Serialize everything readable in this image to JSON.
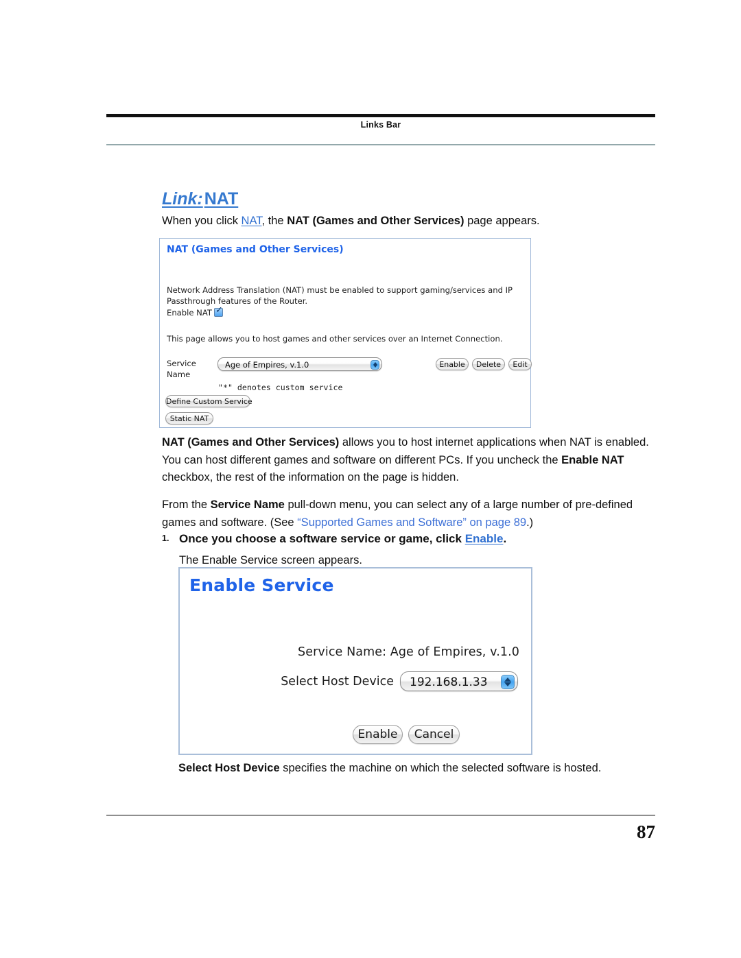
{
  "header": {
    "running_head": "Links Bar"
  },
  "heading": {
    "prefix": "Link:",
    "name": "NAT"
  },
  "intro": {
    "part1": "When you click ",
    "link": "NAT",
    "part2": ", the ",
    "bold": "NAT (Games and Other Services)",
    "part3": " page appears."
  },
  "nat_screenshot": {
    "panel_title": "NAT (Games and Other Services)",
    "description": "Network Address Translation (NAT) must be enabled to support gaming/services and IP Passthrough features of the Router.",
    "enable_nat_label": "Enable NAT",
    "enable_nat_checked": true,
    "host_description": "This page allows you to host games and other services over an Internet Connection.",
    "service_name_label": "Service Name",
    "service_name_value": "Age of Empires, v.1.0",
    "denotes_note": "\"*\" denotes custom service",
    "buttons": {
      "enable": "Enable",
      "delete": "Delete",
      "edit": "Edit",
      "define_custom_service": "Define Custom Service",
      "static_nat": "Static NAT"
    }
  },
  "nat_paragraph": {
    "bold1": "NAT (Games and Other Services)",
    "text1": " allows you to host internet applications when NAT is enabled. You can host different games and software on different PCs. If you uncheck the ",
    "bold2": "Enable NAT",
    "text2": " checkbox, the rest of the information on the page is hidden."
  },
  "service_paragraph": {
    "text1": "From the ",
    "bold1": "Service Name",
    "text2": " pull-down menu, you can select any of a large number of pre-defined games and software. (See ",
    "xref": "“Supported Games and Software” on page 89",
    "text3": ".)"
  },
  "step": {
    "number": "1.",
    "title_part1": "Once you choose a software service or game, click ",
    "title_link": "Enable",
    "title_part2": ".",
    "body": "The Enable Service screen appears."
  },
  "enable_service_screenshot": {
    "panel_title": "Enable Service",
    "service_name": "Service Name: Age of Empires, v.1.0",
    "host_label": "Select Host Device",
    "host_value": "192.168.1.33",
    "buttons": {
      "enable": "Enable",
      "cancel": "Cancel"
    }
  },
  "host_paragraph": {
    "bold": "Select Host Device",
    "text": " specifies the machine on which the selected software is hosted."
  },
  "footer": {
    "page_number": "87"
  },
  "colors": {
    "heading_blue": "#3579cf",
    "panel_title_blue": "#1f63e8",
    "link_blue": "#2f6fd0",
    "xref_blue": "#3c6fd6",
    "panel_border": "#9fb8d8",
    "rule_dark": "#111111",
    "rule_light": "#93a8ab"
  }
}
